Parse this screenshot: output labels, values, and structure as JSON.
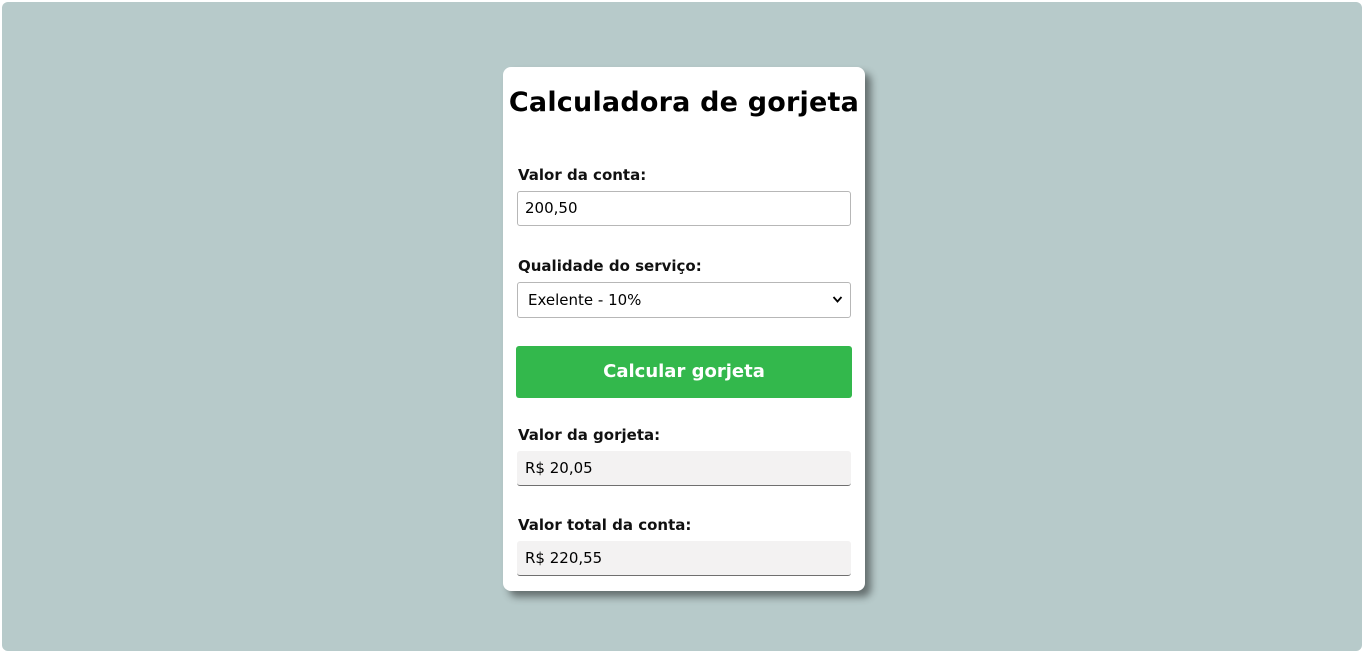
{
  "card": {
    "title": "Calculadora de gorjeta",
    "bill": {
      "label": "Valor da conta:",
      "value": "200,50"
    },
    "service": {
      "label": "Qualidade do serviço:",
      "selected": "Exelente - 10%"
    },
    "calculate_button": "Calcular gorjeta",
    "tip": {
      "label": "Valor da gorjeta:",
      "value": "R$ 20,05"
    },
    "total": {
      "label": "Valor total da conta:",
      "value": "R$ 220,55"
    }
  },
  "colors": {
    "background": "#b7caca",
    "button": "#33b84c",
    "output_bg": "#f3f2f2"
  }
}
